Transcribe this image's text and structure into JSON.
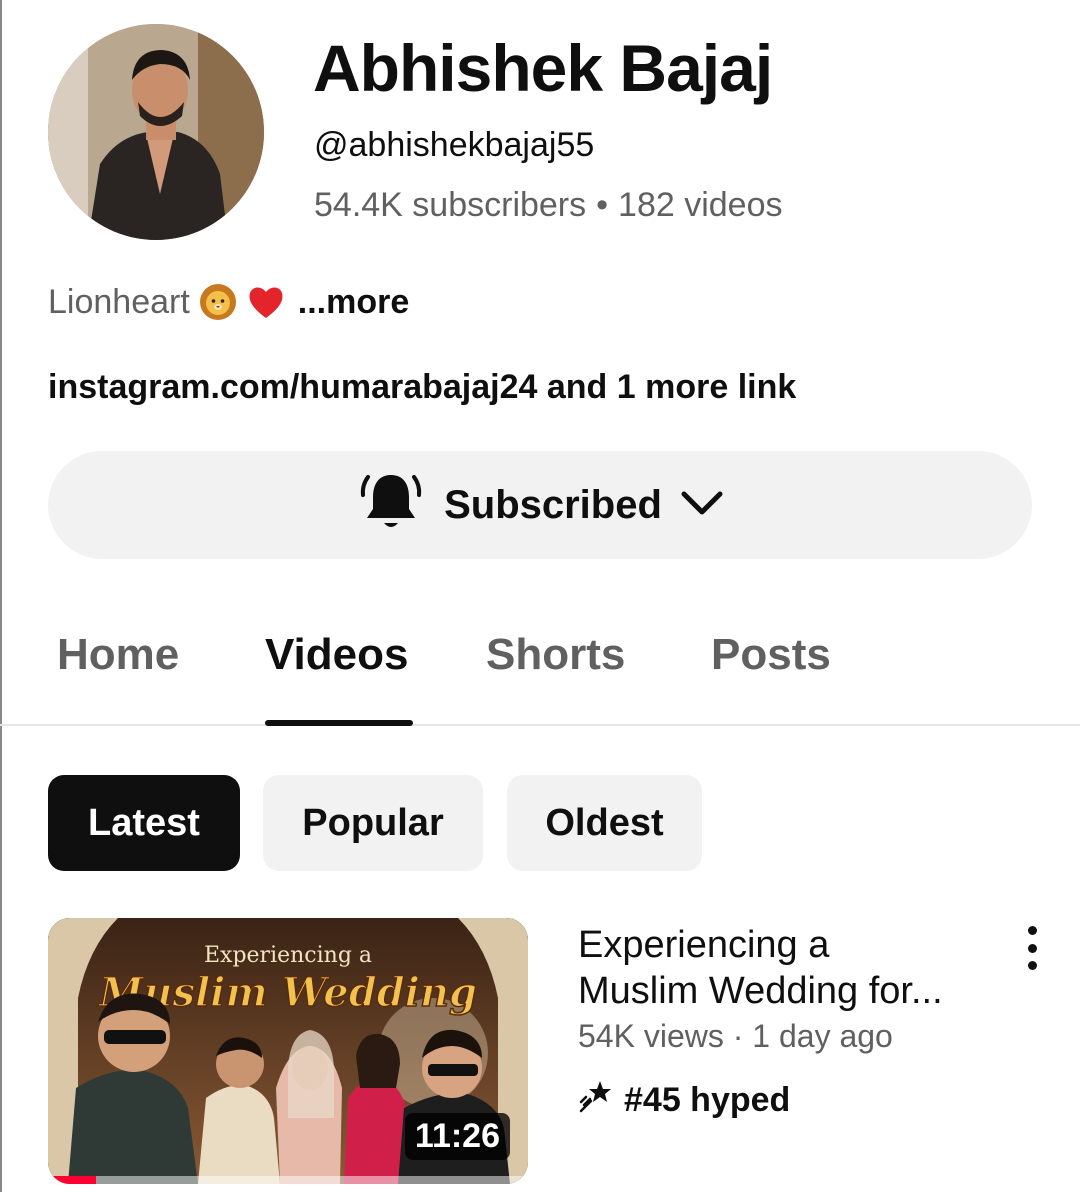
{
  "channel": {
    "name": "Abhishek Bajaj",
    "handle": "@abhishekbajaj55",
    "subscribers": "54.4K subscribers",
    "separator": "•",
    "videos": "182 videos",
    "bio": "Lionheart",
    "bio_more": "...more",
    "link": "instagram.com/humarabajaj24",
    "link_more": " and 1 more link"
  },
  "subscribe": {
    "label": "Subscribed",
    "icon": "bell-icon",
    "dropdown_icon": "chevron-down-icon"
  },
  "tabs": [
    {
      "label": "Home",
      "active": false
    },
    {
      "label": "Videos",
      "active": true
    },
    {
      "label": "Shorts",
      "active": false
    },
    {
      "label": "Posts",
      "active": false
    }
  ],
  "chips": [
    {
      "label": "Latest",
      "selected": true
    },
    {
      "label": "Popular",
      "selected": false
    },
    {
      "label": "Oldest",
      "selected": false
    }
  ],
  "video": {
    "title_line1": "Experiencing a",
    "title_line2": "Muslim Wedding for...",
    "meta": "54K views · 1 day ago",
    "hype": "#45 hyped",
    "duration": "11:26",
    "thumb_caption_small": "Experiencing a",
    "thumb_caption_big": "Muslim Wedding",
    "watch_progress": 0.1
  },
  "colors": {
    "text_primary": "#0f0f0f",
    "text_secondary": "#606060",
    "chip_bg": "#f2f2f2",
    "progress_red": "#ff0033"
  }
}
